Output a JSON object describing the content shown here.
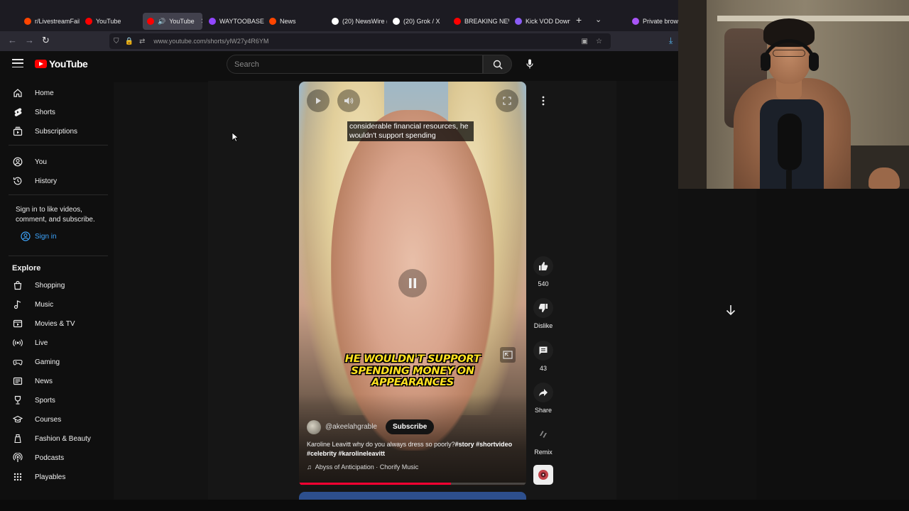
{
  "browser": {
    "tabs": [
      {
        "label": "r/LivestreamFail",
        "color": "#ff4500",
        "active": false
      },
      {
        "label": "YouTube",
        "color": "#ff0000",
        "active": false
      },
      {
        "label": "YouTube",
        "color": "#ff0000",
        "active": true
      },
      {
        "label": "WAYTOOBASED",
        "color": "#9146ff",
        "active": false
      },
      {
        "label": "News",
        "color": "#ff4500",
        "active": false
      },
      {
        "label": "(20) NewsWire (",
        "color": "#ffffff",
        "active": false
      },
      {
        "label": "(20) Grok / X",
        "color": "#ffffff",
        "active": false
      },
      {
        "label": "BREAKING NEW",
        "color": "#ff0000",
        "active": false
      },
      {
        "label": "Kick VOD Down",
        "color": "#8b5cf6",
        "active": false
      },
      {
        "label": "Private browsi",
        "color": "#a855f7",
        "active": false
      }
    ],
    "new_tab": "+",
    "tab_list": "⌄",
    "url": "www.youtube.com/shorts/ylW27y4R6YM"
  },
  "youtube": {
    "logo_text": "YouTube",
    "search_placeholder": "Search",
    "brand_color": "#ff0000"
  },
  "sidebar": {
    "primary": [
      {
        "label": "Home",
        "icon": "home-icon"
      },
      {
        "label": "Shorts",
        "icon": "shorts-icon"
      },
      {
        "label": "Subscriptions",
        "icon": "subscriptions-icon"
      }
    ],
    "you": [
      {
        "label": "You",
        "icon": "you-icon"
      },
      {
        "label": "History",
        "icon": "history-icon"
      }
    ],
    "signin_prompt": "Sign in to like videos, comment, and subscribe.",
    "signin_label": "Sign in",
    "explore_title": "Explore",
    "explore": [
      {
        "label": "Shopping",
        "icon": "shopping-icon"
      },
      {
        "label": "Music",
        "icon": "music-icon"
      },
      {
        "label": "Movies & TV",
        "icon": "movies-icon"
      },
      {
        "label": "Live",
        "icon": "live-icon"
      },
      {
        "label": "Gaming",
        "icon": "gaming-icon"
      },
      {
        "label": "News",
        "icon": "news-icon"
      },
      {
        "label": "Sports",
        "icon": "sports-icon"
      },
      {
        "label": "Courses",
        "icon": "courses-icon"
      },
      {
        "label": "Fashion & Beauty",
        "icon": "fashion-icon"
      },
      {
        "label": "Podcasts",
        "icon": "podcasts-icon"
      },
      {
        "label": "Playables",
        "icon": "playables-icon"
      }
    ]
  },
  "short": {
    "caption_text": "considerable financial resources, he wouldn't support spending",
    "burned_caption": "HE WOULDN'T SUPPORT SPENDING MONEY ON APPEARANCES",
    "channel": "@akeelahgrable",
    "subscribe_label": "Subscribe",
    "description": "Karoline Leavitt why do you always dress so poorly?",
    "hashtags": "#story #shortvideo #celebrity #karolineleavitt",
    "music": "Abyss of Anticipation · Chorify Music",
    "progress": 0.67,
    "progress_color": "#ff0033"
  },
  "actions": {
    "likes": "540",
    "dislike_label": "Dislike",
    "comments": "43",
    "share_label": "Share",
    "remix_label": "Remix"
  }
}
